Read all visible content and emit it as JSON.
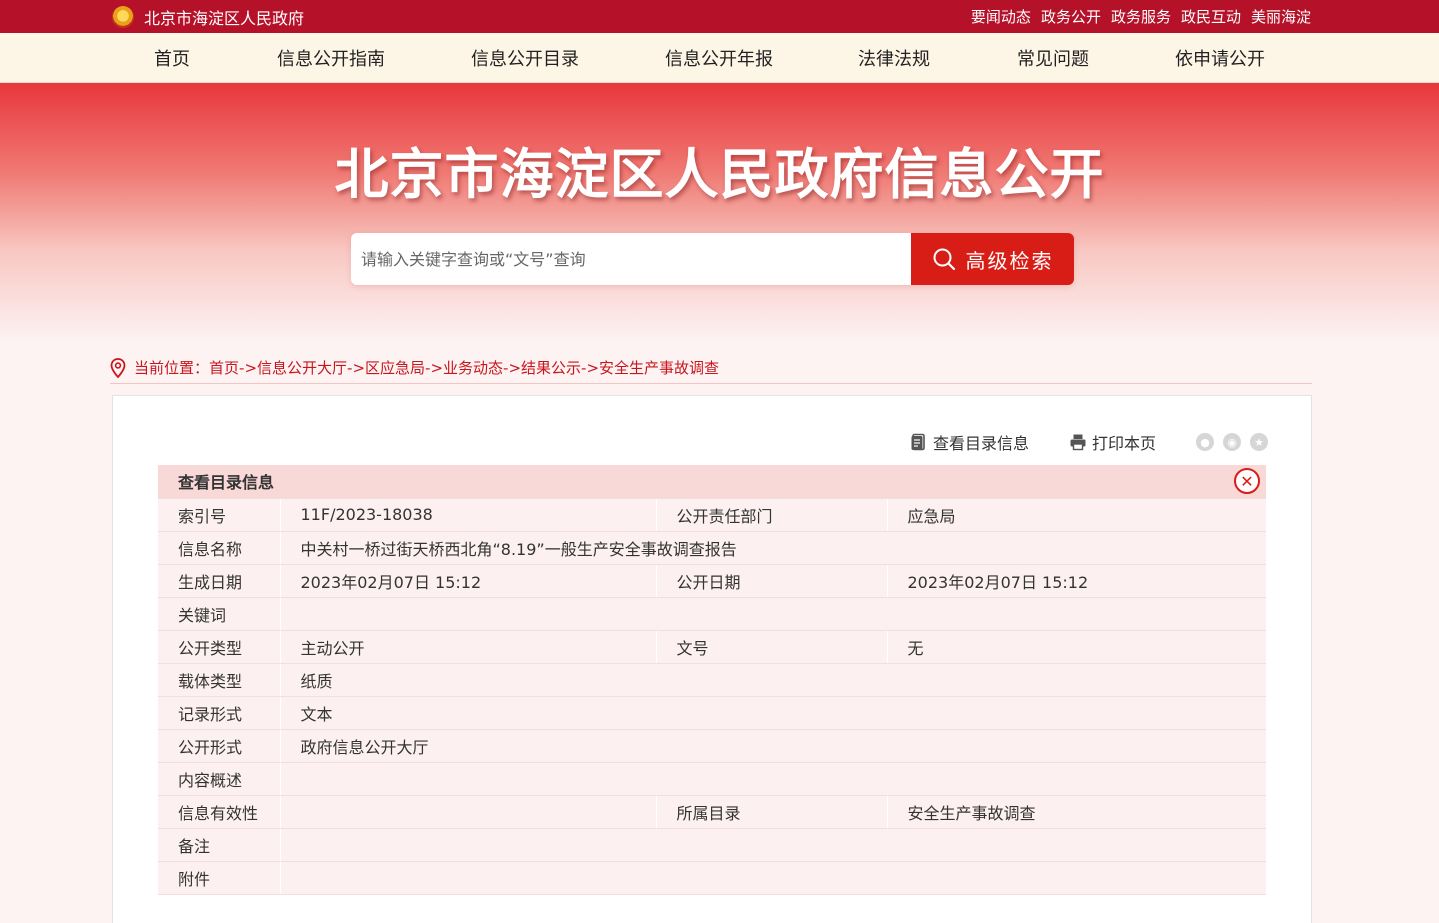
{
  "topbar": {
    "site_name": "北京市海淀区人民政府",
    "links": [
      "要闻动态",
      "政务公开",
      "政务服务",
      "政民互动",
      "美丽海淀"
    ]
  },
  "nav": {
    "items": [
      "首页",
      "信息公开指南",
      "信息公开目录",
      "信息公开年报",
      "法律法规",
      "常见问题",
      "依申请公开"
    ]
  },
  "hero": {
    "title": "北京市海淀区人民政府信息公开"
  },
  "search": {
    "placeholder": "请输入关键字查询或“文号”查询",
    "button_label": "高级检索"
  },
  "breadcrumb": {
    "prefix": "当前位置：",
    "items": [
      "首页",
      "信息公开大厅",
      "区应急局",
      "业务动态",
      "结果公示",
      "安全生产事故调查"
    ],
    "separator": "->"
  },
  "tools": {
    "catalog_label": "查看目录信息",
    "print_label": "打印本页"
  },
  "info_table": {
    "title": "查看目录信息",
    "rows": {
      "index_label": "索引号",
      "index_value": "11F/2023-18038",
      "dept_label": "公开责任部门",
      "dept_value": "应急局",
      "name_label": "信息名称",
      "name_value": "中关村一桥过街天桥西北角“8.19”一般生产安全事故调查报告",
      "created_label": "生成日期",
      "created_value": "2023年02月07日 15:12",
      "published_label": "公开日期",
      "published_value": "2023年02月07日 15:12",
      "keywords_label": "关键词",
      "keywords_value": "",
      "type_label": "公开类型",
      "type_value": "主动公开",
      "docno_label": "文号",
      "docno_value": "无",
      "carrier_label": "载体类型",
      "carrier_value": "纸质",
      "record_label": "记录形式",
      "record_value": "文本",
      "form_label": "公开形式",
      "form_value": "政府信息公开大厅",
      "summary_label": "内容概述",
      "summary_value": "",
      "validity_label": "信息有效性",
      "validity_value": "",
      "category_label": "所属目录",
      "category_value": "安全生产事故调查",
      "remark_label": "备注",
      "remark_value": "",
      "attach_label": "附件",
      "attach_value": ""
    }
  },
  "colors": {
    "primary_red": "#b5122a",
    "button_red": "#d81d16",
    "nav_bg": "#fdf5e6",
    "row_bg": "#fdf0f0",
    "head_bg": "#f9d8d8"
  }
}
